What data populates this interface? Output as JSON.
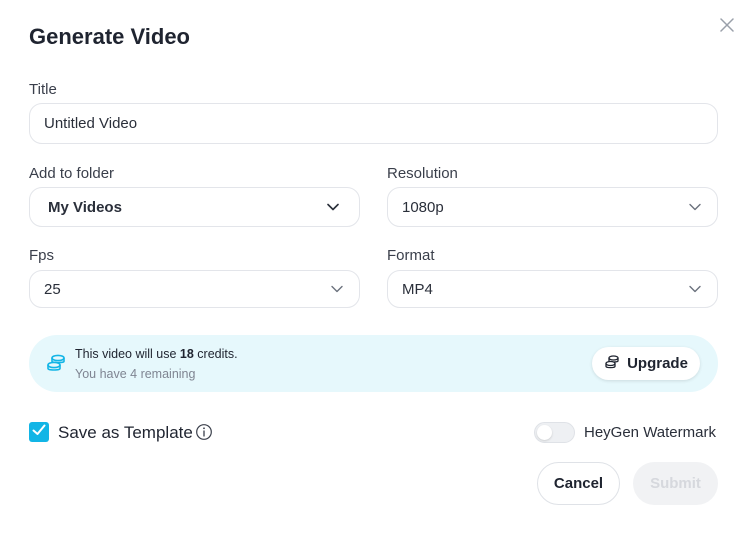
{
  "dialog": {
    "title": "Generate Video"
  },
  "fields": {
    "title_label": "Title",
    "title_value": "Untitled Video",
    "folder_label": "Add to folder",
    "folder_value": "My Videos",
    "resolution_label": "Resolution",
    "resolution_value": "1080p",
    "fps_label": "Fps",
    "fps_value": "25",
    "format_label": "Format",
    "format_value": "MP4"
  },
  "credits": {
    "line_prefix": "This video will use ",
    "amount": "18",
    "line_suffix": " credits.",
    "remaining": "You have 4 remaining",
    "upgrade_label": "Upgrade",
    "accent": "#12b5e6",
    "background": "#e6f8fc"
  },
  "options": {
    "save_template_label": "Save as Template",
    "save_template_checked": true,
    "watermark_label": "HeyGen Watermark",
    "watermark_enabled": false
  },
  "actions": {
    "cancel_label": "Cancel",
    "submit_label": "Submit"
  },
  "icons": {
    "close": "close-icon",
    "chevron": "chevron-down-icon",
    "coins": "coins-icon",
    "info": "info-icon",
    "check": "check-icon"
  }
}
